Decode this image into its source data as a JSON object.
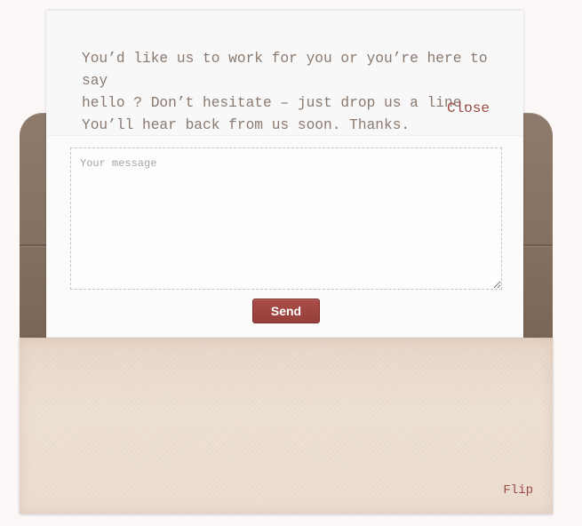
{
  "letter": {
    "message": "You’d like us to work for you or you’re here to say\nhello ? Don’t hesitate – just drop us a line.\nYou’ll hear back from us soon. Thanks.",
    "close_label": "Close"
  },
  "form": {
    "message_placeholder": "Your message",
    "message_value": "",
    "send_label": "Send"
  },
  "envelope": {
    "flip_label": "Flip"
  },
  "colors": {
    "accent": "#9a4a44",
    "button": "#a4453f",
    "leather": "#8a7666",
    "paper": "#ecdcd0"
  }
}
